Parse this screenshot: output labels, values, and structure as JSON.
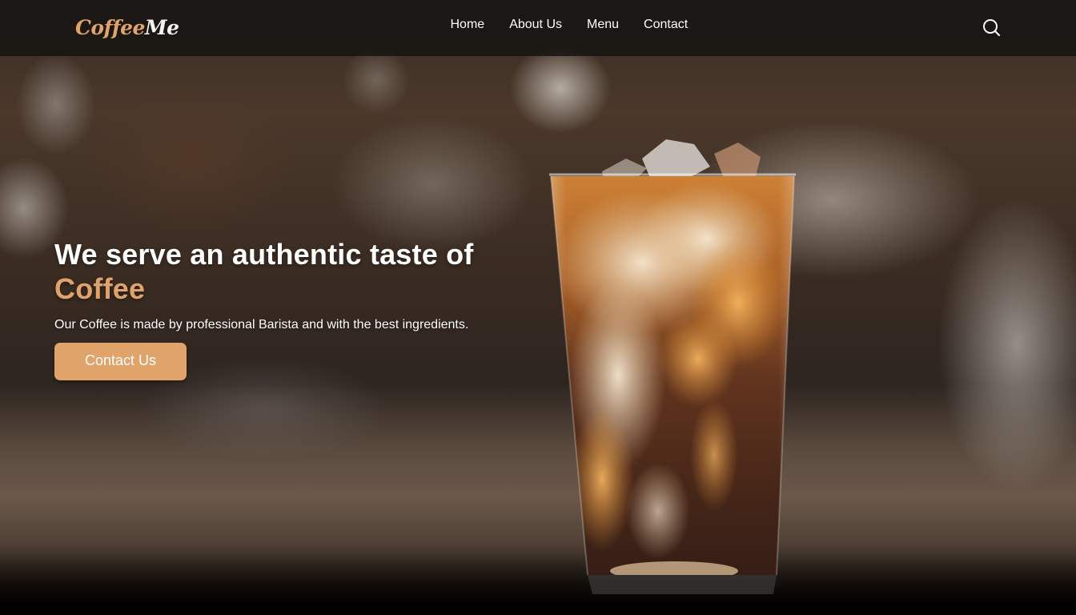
{
  "brand": {
    "logo_part1": "Coffee",
    "logo_part2": "Me",
    "accent_color": "#e0a36a"
  },
  "nav": {
    "items": [
      {
        "label": "Home"
      },
      {
        "label": "About Us"
      },
      {
        "label": "Menu"
      },
      {
        "label": "Contact"
      }
    ],
    "search_icon": "search-icon"
  },
  "hero": {
    "title_line1": "We serve an authentic taste of",
    "title_accent": "Coffee",
    "subtitle": "Our Coffee is made by professional Barista and with the best ingredients.",
    "cta_label": "Contact Us",
    "image": "iced-coffee-glass"
  }
}
